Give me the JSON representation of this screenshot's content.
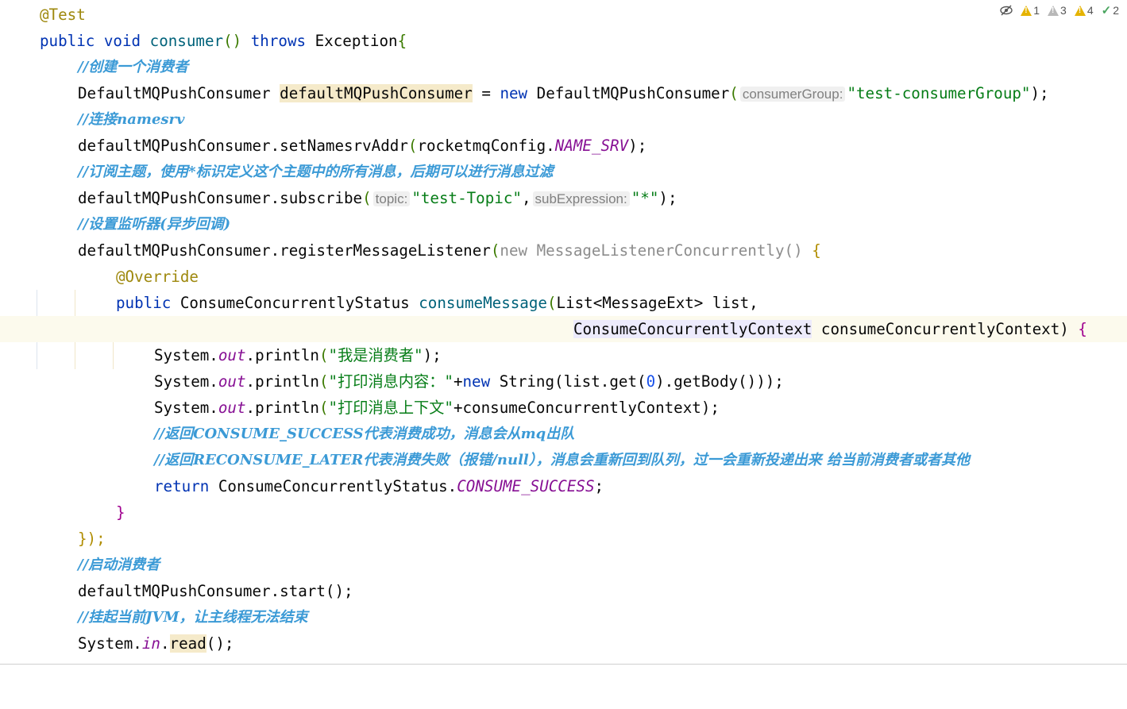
{
  "status": {
    "errors_count": "1",
    "warnings_gray_count": "3",
    "warnings_count": "4",
    "checks_count": "2"
  },
  "code": {
    "l1_ann": "@Test",
    "l2_public": "public",
    "l2_void": "void",
    "l2_name": "consumer",
    "l2_parens": "()",
    "l2_throws": "throws",
    "l2_exc": "Exception",
    "l2_brace": "{",
    "l3_cmt": "//创建一个消费者",
    "l4_type": "DefaultMQPushConsumer",
    "l4_var": "defaultMQPushConsumer",
    "l4_eq": "=",
    "l4_new": "new",
    "l4_ctor": "DefaultMQPushConsumer",
    "l4_hint": "consumerGroup:",
    "l4_str": "\"test-consumerGroup\"",
    "l4_end": ");",
    "l5_cmt": "//连接namesrv",
    "l6_obj": "defaultMQPushConsumer.setNamesrvAddr",
    "l6_arg": "rocketmqConfig.",
    "l6_const": "NAME_SRV",
    "l6_end": ");",
    "l7_cmt": "//订阅主题，使用*标识定义这个主题中的所有消息，后期可以进行消息过滤",
    "l8_call": "defaultMQPushConsumer.subscribe",
    "l8_hint1": "topic:",
    "l8_str1": "\"test-Topic\"",
    "l8_comma": ",",
    "l8_hint2": "subExpression:",
    "l8_str2": "\"*\"",
    "l8_end": ");",
    "l9_cmt": "//设置监听器(异步回调)",
    "l10_call": "defaultMQPushConsumer.registerMessageListener",
    "l10_new": "new MessageListenerConcurrently()",
    "l10_brace": "{",
    "l11_ann": "@Override",
    "l12_public": "public",
    "l12_type": "ConsumeConcurrentlyStatus",
    "l12_meth": "consumeMessage",
    "l12_params": "List<MessageExt> list,",
    "l13_type": "ConsumeConcurrentlyContext",
    "l13_var": "consumeConcurrentlyContext",
    "l13_end": ")",
    "l13_brace": "{",
    "l14_sys": "System.",
    "l14_out": "out",
    "l14_call": ".println",
    "l14_str": "\"我是消费者\"",
    "l14_end": ");",
    "l15_sys": "System.",
    "l15_out": "out",
    "l15_call": ".println",
    "l15_str": "\"打印消息内容：\"",
    "l15_plus": "+",
    "l15_new": "new",
    "l15_rest": "String(list.get(",
    "l15_num": "0",
    "l15_tail": ").getBody()));",
    "l16_sys": "System.",
    "l16_out": "out",
    "l16_call": ".println",
    "l16_str": "\"打印消息上下文\"",
    "l16_rest": "+consumeConcurrentlyContext);",
    "l17_cmt": "//返回CONSUME_SUCCESS代表消费成功，消息会从mq出队",
    "l18_cmt": "//返回RECONSUME_LATER代表消费失败（报错/null），消息会重新回到队列，过一会重新投递出来 给当前消费者或者其他",
    "l19_return": "return",
    "l19_cls": "ConsumeConcurrentlyStatus.",
    "l19_const": "CONSUME_SUCCESS",
    "l19_end": ";",
    "l20_brace": "}",
    "l21_close": "});",
    "l22_cmt": "//启动消费者",
    "l23_call": "defaultMQPushConsumer.start",
    "l23_end": "();",
    "l24_cmt": "//挂起当前JVM，让主线程无法结束",
    "l25_sys": "System.",
    "l25_in": "in",
    "l25_dot": ".",
    "l25_read": "read",
    "l25_end": "();"
  }
}
